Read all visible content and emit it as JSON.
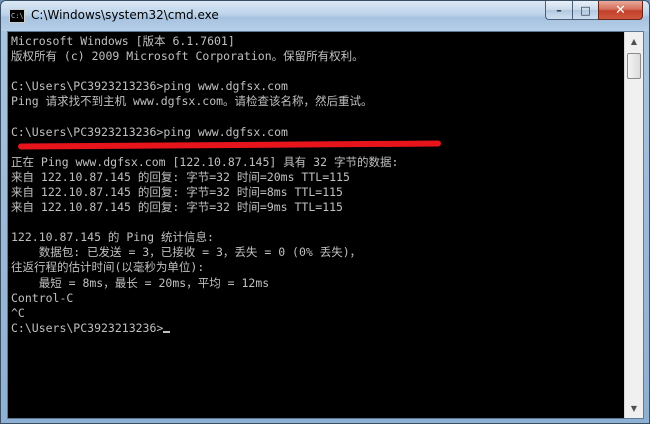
{
  "window": {
    "title": "C:\\Windows\\system32\\cmd.exe",
    "icon_text": "C:\\"
  },
  "caption": {
    "minimize": "–",
    "maximize": "□",
    "close": "✕"
  },
  "console": {
    "lines": [
      "Microsoft Windows [版本 6.1.7601]",
      "版权所有 (c) 2009 Microsoft Corporation。保留所有权利。",
      "",
      "C:\\Users\\PC3923213236>ping www.dgfsx.com",
      "Ping 请求找不到主机 www.dgfsx.com。请检查该名称，然后重试。",
      "",
      "C:\\Users\\PC3923213236>ping www.dgfsx.com",
      "",
      "正在 Ping www.dgfsx.com [122.10.87.145] 具有 32 字节的数据:",
      "来自 122.10.87.145 的回复: 字节=32 时间=20ms TTL=115",
      "来自 122.10.87.145 的回复: 字节=32 时间=8ms TTL=115",
      "来自 122.10.87.145 的回复: 字节=32 时间=9ms TTL=115",
      "",
      "122.10.87.145 的 Ping 统计信息:",
      "    数据包: 已发送 = 3，已接收 = 3，丢失 = 0 (0% 丢失)，",
      "往返行程的估计时间(以毫秒为单位):",
      "    最短 = 8ms，最长 = 20ms，平均 = 12ms",
      "Control-C",
      "^C",
      "C:\\Users\\PC3923213236>"
    ]
  },
  "colors": {
    "console_bg": "#000000",
    "console_fg": "#c0c0c0",
    "annotation_underline": "#e8141b"
  }
}
